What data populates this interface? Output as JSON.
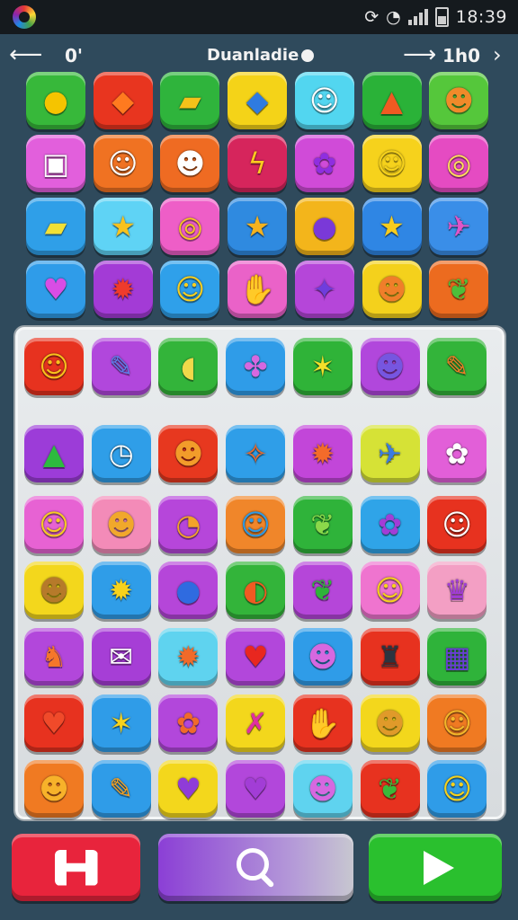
{
  "status_bar": {
    "time": "18:39",
    "app_icon": "color-wheel-icon",
    "icons": [
      "sync-icon",
      "wifi-icon",
      "signal-icon",
      "battery-icon"
    ]
  },
  "top_bar": {
    "left_text": "0'",
    "title": "Duanladie",
    "right_text": "1h0",
    "icons": [
      "back-arrow-icon",
      "info-icon",
      "forward-arrow-icon",
      "chevron-right-icon"
    ]
  },
  "top_grid": [
    [
      {
        "bg": "#37b83a",
        "g": "●",
        "c": "#f5c400"
      },
      {
        "bg": "#e8351f",
        "g": "◆",
        "c": "#ff7a1f"
      },
      {
        "bg": "#2fb43c",
        "g": "▰",
        "c": "#f4c21a"
      },
      {
        "bg": "#f4d318",
        "g": "◆",
        "c": "#2f7be0"
      },
      {
        "bg": "#52d6f0",
        "g": "☺",
        "c": "#ffffff"
      },
      {
        "bg": "#2ab238",
        "g": "▲",
        "c": "#ef5a22"
      },
      {
        "bg": "#55c73b",
        "g": "☻",
        "c": "#f08a2a"
      }
    ],
    [
      {
        "bg": "#e25fdc",
        "g": "▣",
        "c": "#ffffff"
      },
      {
        "bg": "#f07222",
        "g": "☺",
        "c": "#ffffff"
      },
      {
        "bg": "#ef6b22",
        "g": "☻",
        "c": "#ffffff"
      },
      {
        "bg": "#d6255c",
        "g": "ϟ",
        "c": "#ffcb1f"
      },
      {
        "bg": "#d04bd8",
        "g": "✿",
        "c": "#8f2ee0"
      },
      {
        "bg": "#f6d21c",
        "g": "☺",
        "c": "#f6d21c"
      },
      {
        "bg": "#e54bc2",
        "g": "◎",
        "c": "#ffe05a"
      }
    ],
    [
      {
        "bg": "#2f9fe8",
        "g": "▰",
        "c": "#f2e036"
      },
      {
        "bg": "#5fd3f5",
        "g": "★",
        "c": "#f7c21d"
      },
      {
        "bg": "#ee5ec7",
        "g": "◎",
        "c": "#f8c71f"
      },
      {
        "bg": "#2f8ae0",
        "g": "★",
        "c": "#f5b21e"
      },
      {
        "bg": "#f3b51b",
        "g": "●",
        "c": "#7a39d8"
      },
      {
        "bg": "#2f86e4",
        "g": "★",
        "c": "#f7cc1c"
      },
      {
        "bg": "#3a8ee8",
        "g": "✈",
        "c": "#e055c8"
      }
    ],
    [
      {
        "bg": "#2f9ce9",
        "g": "♥",
        "c": "#d84de5"
      },
      {
        "bg": "#a33bd6",
        "g": "✹",
        "c": "#ef3b2c"
      },
      {
        "bg": "#2fa0ea",
        "g": "☺",
        "c": "#f9cf20"
      },
      {
        "bg": "#ea62c8",
        "g": "✋",
        "c": "#f5a821"
      },
      {
        "bg": "#b546d9",
        "g": "✦",
        "c": "#6f3ddc"
      },
      {
        "bg": "#f4d11c",
        "g": "☻",
        "c": "#f07e2a"
      },
      {
        "bg": "#ec6b1f",
        "g": "❦",
        "c": "#4cbf3a"
      }
    ]
  ],
  "board_grid": [
    [
      {
        "bg": "#e7321f",
        "g": "☺",
        "c": "#f8c11c"
      },
      {
        "bg": "#b147dc",
        "g": "✎",
        "c": "#5d7de8"
      },
      {
        "bg": "#33b43a",
        "g": "◖",
        "c": "#f0d94a"
      },
      {
        "bg": "#2f9ce8",
        "g": "✤",
        "c": "#d668e0"
      },
      {
        "bg": "#2fb338",
        "g": "✶",
        "c": "#f3e02a"
      },
      {
        "bg": "#b147dc",
        "g": "☻",
        "c": "#7656e0"
      },
      {
        "bg": "#33b43a",
        "g": "✎",
        "c": "#ef7b26"
      }
    ],
    [
      {
        "bg": "#9c3cd8",
        "g": "▲",
        "c": "#2dbb3f"
      },
      {
        "bg": "#2f9ee8",
        "g": "◷",
        "c": "#ffffff"
      },
      {
        "bg": "#e7381f",
        "g": "☻",
        "c": "#f29c2a"
      },
      {
        "bg": "#2f9ee8",
        "g": "✧",
        "c": "#ee6a2a"
      },
      {
        "bg": "#c246d9",
        "g": "✹",
        "c": "#f36b2a"
      },
      {
        "bg": "#d6e236",
        "g": "✈",
        "c": "#3a7be2"
      },
      {
        "bg": "#e25fd8",
        "g": "✿",
        "c": "#ffffff"
      }
    ],
    [
      {
        "bg": "#e762d3",
        "g": "☺",
        "c": "#f7cc22"
      },
      {
        "bg": "#f38bb8",
        "g": "☻",
        "c": "#f1a82b"
      },
      {
        "bg": "#b646da",
        "g": "◔",
        "c": "#f2a42a"
      },
      {
        "bg": "#f0862a",
        "g": "☺",
        "c": "#2d9ae6"
      },
      {
        "bg": "#2fb33a",
        "g": "❦",
        "c": "#8bd84a"
      },
      {
        "bg": "#2fa4e8",
        "g": "✿",
        "c": "#a23dd6"
      },
      {
        "bg": "#e7321f",
        "g": "☺",
        "c": "#ffffff"
      }
    ],
    [
      {
        "bg": "#f3d71c",
        "g": "☻",
        "c": "#b67a2a"
      },
      {
        "bg": "#2f9de8",
        "g": "✹",
        "c": "#f7d21c"
      },
      {
        "bg": "#b546d9",
        "g": "●",
        "c": "#2f6be0"
      },
      {
        "bg": "#33b43a",
        "g": "◐",
        "c": "#f05a22"
      },
      {
        "bg": "#b546d9",
        "g": "❦",
        "c": "#2fb33a"
      },
      {
        "bg": "#ef74cf",
        "g": "☺",
        "c": "#f7d21c"
      },
      {
        "bg": "#f39fc4",
        "g": "♛",
        "c": "#a23dd6"
      }
    ],
    [
      {
        "bg": "#b247db",
        "g": "♞",
        "c": "#f5772a"
      },
      {
        "bg": "#a63ed6",
        "g": "✉",
        "c": "#ffffff"
      },
      {
        "bg": "#5fd3ef",
        "g": "✹",
        "c": "#f06a2a"
      },
      {
        "bg": "#b247db",
        "g": "♥",
        "c": "#e8271f"
      },
      {
        "bg": "#2f9ce8",
        "g": "☻",
        "c": "#d668e0"
      },
      {
        "bg": "#e7321f",
        "g": "♜",
        "c": "#2c3440"
      },
      {
        "bg": "#2fb33a",
        "g": "▦",
        "c": "#6b3dd8"
      }
    ],
    [
      {
        "bg": "#e7321f",
        "g": "♥",
        "c": "#f04a2a"
      },
      {
        "bg": "#2f9ce8",
        "g": "✶",
        "c": "#f7d21c"
      },
      {
        "bg": "#b247db",
        "g": "✿",
        "c": "#f06a2a"
      },
      {
        "bg": "#f3d71c",
        "g": "✗",
        "c": "#e02fa0"
      },
      {
        "bg": "#e7321f",
        "g": "✋",
        "c": "#f5a021"
      },
      {
        "bg": "#f3d71c",
        "g": "☻",
        "c": "#e09a2a"
      },
      {
        "bg": "#f07a22",
        "g": "☺",
        "c": "#f3b72a"
      }
    ],
    [
      {
        "bg": "#f07a22",
        "g": "☻",
        "c": "#f7b22a"
      },
      {
        "bg": "#2f9ce8",
        "g": "✎",
        "c": "#f5a021"
      },
      {
        "bg": "#f3d71c",
        "g": "♥",
        "c": "#8f3cd8"
      },
      {
        "bg": "#b247db",
        "g": "♥",
        "c": "#a23dd6"
      },
      {
        "bg": "#5fd3ef",
        "g": "☻",
        "c": "#d668e0"
      },
      {
        "bg": "#e7321f",
        "g": "❦",
        "c": "#3ab83a"
      },
      {
        "bg": "#2f9ce8",
        "g": "☺",
        "c": "#f7d21c"
      }
    ]
  ],
  "bottom_buttons": {
    "left_icon": "h-logo-icon",
    "center_icon": "search-icon",
    "right_icon": "play-icon"
  }
}
